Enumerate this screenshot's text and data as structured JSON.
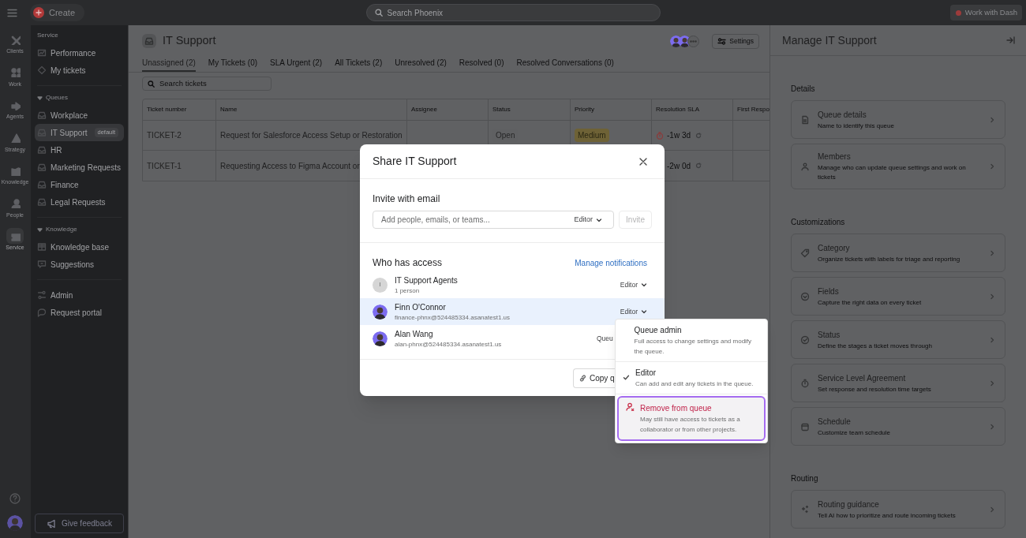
{
  "top_bar": {
    "create_label": "Create",
    "search_placeholder": "Search Phoenix",
    "dash_button": "Work with Dash"
  },
  "rail": [
    {
      "label": "Clients",
      "selected": false
    },
    {
      "label": "Work",
      "selected": false
    },
    {
      "label": "Agents",
      "selected": false
    },
    {
      "label": "Strategy",
      "selected": false
    },
    {
      "label": "Knowledge",
      "selected": false
    },
    {
      "label": "People",
      "selected": false
    },
    {
      "label": "Service",
      "selected": true
    }
  ],
  "sidebar": {
    "sections": [
      {
        "title": "Service",
        "items": [
          {
            "label": "Performance",
            "selected": false
          },
          {
            "label": "My tickets",
            "selected": false
          }
        ]
      },
      {
        "title": "Queues",
        "expanded": true,
        "items": [
          {
            "label": "Workplace",
            "selected": false
          },
          {
            "label": "IT Support",
            "badge": "default",
            "selected": true
          },
          {
            "label": "HR",
            "selected": false
          },
          {
            "label": "Marketing Requests",
            "selected": false
          },
          {
            "label": "Finance",
            "selected": false
          },
          {
            "label": "Legal Requests",
            "selected": false
          }
        ]
      },
      {
        "title": "Knowledge",
        "expanded": true,
        "items": [
          {
            "label": "Knowledge base",
            "selected": false
          },
          {
            "label": "Suggestions",
            "selected": false
          }
        ]
      },
      {
        "items": [
          {
            "label": "Admin",
            "selected": false
          },
          {
            "label": "Request portal",
            "selected": false
          }
        ]
      }
    ],
    "feedback_button": "Give feedback"
  },
  "page": {
    "title": "IT Support",
    "settings_label": "Settings",
    "tabs": [
      {
        "label": "Unassigned (2)",
        "selected": true
      },
      {
        "label": "My Tickets (0)",
        "selected": false
      },
      {
        "label": "SLA Urgent (2)",
        "selected": false
      },
      {
        "label": "All Tickets (2)",
        "selected": false
      },
      {
        "label": "Unresolved (2)",
        "selected": false
      },
      {
        "label": "Resolved (0)",
        "selected": false
      },
      {
        "label": "Resolved Conversations (0)",
        "selected": false
      }
    ],
    "search_placeholder": "Search tickets",
    "table": {
      "columns": [
        "Ticket number",
        "Name",
        "Assignee",
        "Status",
        "Priority",
        "Resolution SLA",
        "First Respo"
      ],
      "rows": [
        {
          "ticket": "TICKET-2",
          "name": "Request for Salesforce Access Setup or Restoration",
          "status": "Open",
          "priority": "Medium",
          "sla": "-1w 3d",
          "timer": true
        },
        {
          "ticket": "TICKET-1",
          "name": "Requesting Access to Figma Account or",
          "sla": "-2w 0d"
        }
      ]
    }
  },
  "manage_panel": {
    "title": "Manage IT Support",
    "sections": [
      {
        "title": "Details",
        "cards": [
          {
            "title": "Queue details",
            "description": "Name to identify this queue"
          },
          {
            "title": "Members",
            "description": "Manage who can update queue settings and work on tickets"
          }
        ]
      },
      {
        "title": "Customizations",
        "cards": [
          {
            "title": "Category",
            "description": "Organize tickets with labels for triage and reporting"
          },
          {
            "title": "Fields",
            "description": "Capture the right data on every ticket"
          },
          {
            "title": "Status",
            "description": "Define the stages a ticket moves through"
          },
          {
            "title": "Service Level Agreement",
            "description": "Set response and resolution time targets"
          },
          {
            "title": "Schedule",
            "description": "Customize team schedule"
          }
        ]
      },
      {
        "title": "Routing",
        "cards": [
          {
            "title": "Routing guidance",
            "description": "Tell AI how to prioritize and route incoming tickets"
          }
        ]
      }
    ]
  },
  "share_dialog": {
    "title": "Share IT Support",
    "invite": {
      "heading": "Invite with email",
      "placeholder": "Add people, emails, or teams...",
      "role": "Editor",
      "button": "Invite",
      "button_disabled": true
    },
    "access": {
      "heading": "Who has access",
      "link": "Manage notifications",
      "members": [
        {
          "name": "IT Support Agents",
          "detail": "1 person",
          "initial": "I",
          "role": "Editor",
          "caret": true,
          "selected": false
        },
        {
          "name": "Finn O'Connor",
          "detail": "finance-phnx@524485334.asanatest1.us",
          "role": "Editor",
          "caret": true,
          "selected": true
        },
        {
          "name": "Alan Wang",
          "detail": "alan-phnx@524485334.asanatest1.us",
          "role": "Queu",
          "caret": false,
          "selected": false
        }
      ]
    },
    "copy_button": "Copy q"
  },
  "role_menu": {
    "items": [
      {
        "kind": "option",
        "label": "Queue admin",
        "description": "Full access to change settings and modify the queue.",
        "checked": false,
        "highlighted": false
      },
      {
        "kind": "option",
        "label": "Editor",
        "description": "Can add and edit any tickets in the queue.",
        "checked": true,
        "highlighted": false
      },
      {
        "kind": "danger",
        "label": "Remove from queue",
        "description": "May still have access to tickets as a collaborator or from other projects.",
        "highlighted": true
      }
    ]
  }
}
